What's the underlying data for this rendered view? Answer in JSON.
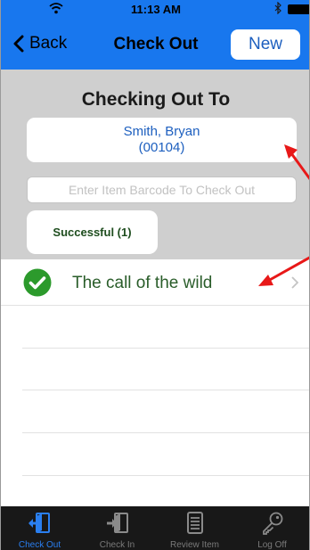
{
  "status_bar": {
    "time": "11:13 AM"
  },
  "nav": {
    "back_label": "Back",
    "title": "Check Out",
    "new_label": "New"
  },
  "checkout": {
    "heading": "Checking Out To",
    "patron_name": "Smith, Bryan",
    "patron_id": "(00104)",
    "barcode_placeholder": "Enter Item Barcode To Check Out",
    "successful_label": "Successful (1)"
  },
  "items": [
    {
      "title": "The call of the wild",
      "status": "success"
    }
  ],
  "tabs": [
    {
      "label": "Check Out",
      "icon": "check-out-icon",
      "active": true
    },
    {
      "label": "Check In",
      "icon": "check-in-icon",
      "active": false
    },
    {
      "label": "Review Item",
      "icon": "review-item-icon",
      "active": false
    },
    {
      "label": "Log Off",
      "icon": "key-icon",
      "active": false
    }
  ],
  "colors": {
    "nav_blue": "#1877ee",
    "header_gray": "#cfcfcf",
    "success_green": "#2c9a2c",
    "annotation_red": "#e81818",
    "tab_active": "#2a7ff0"
  }
}
